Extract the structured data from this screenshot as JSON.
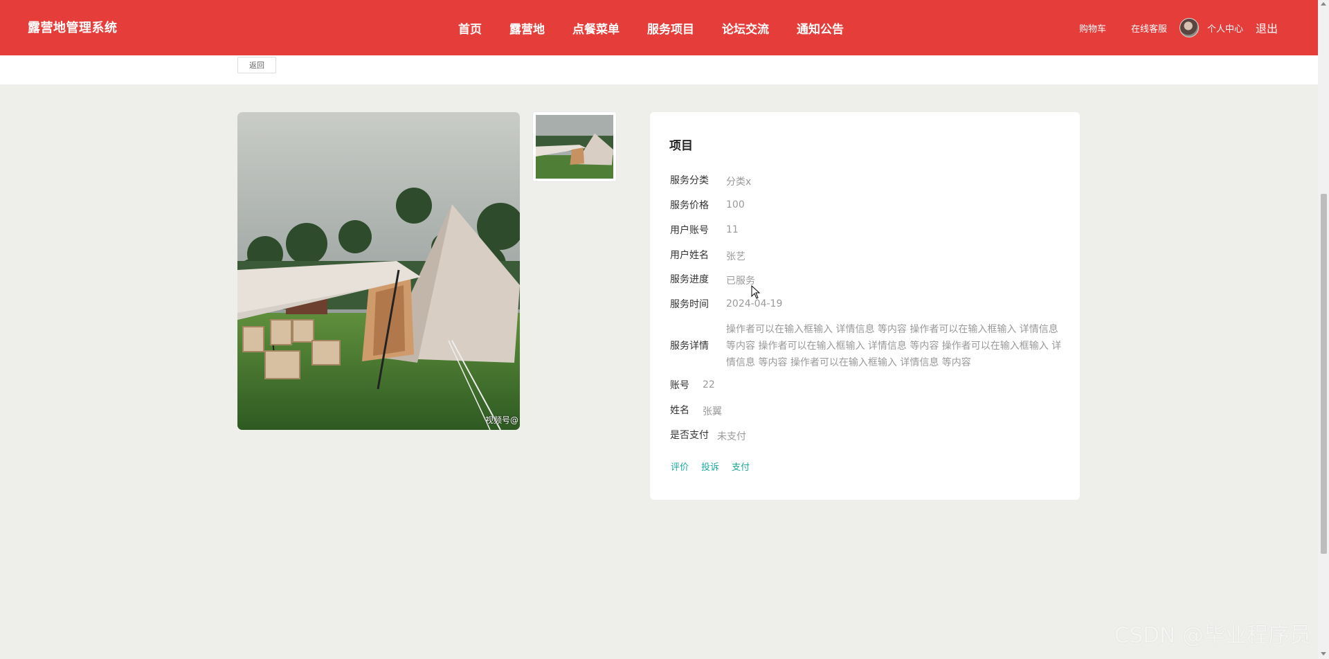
{
  "header": {
    "brand": "露营地管理系统",
    "nav": [
      "首页",
      "露营地",
      "点餐菜单",
      "服务项目",
      "论坛交流",
      "通知公告"
    ],
    "cart": "购物车",
    "online_service": "在线客服",
    "personal_center": "个人中心",
    "logout": "退出"
  },
  "back_button": "返回",
  "image": {
    "overlay_text": "视频号@"
  },
  "detail": {
    "title": "项目",
    "fields": [
      {
        "label": "服务分类",
        "value": "分类x"
      },
      {
        "label": "服务价格",
        "value": "100"
      },
      {
        "label": "用户账号",
        "value": "11"
      },
      {
        "label": "用户姓名",
        "value": "张艺"
      },
      {
        "label": "服务进度",
        "value": "已服务"
      },
      {
        "label": "服务时间",
        "value": "2024-04-19"
      }
    ],
    "service_detail_label": "服务详情",
    "service_detail_value": "操作者可以在输入框输入 详情信息 等内容 操作者可以在输入框输入 详情信息 等内容 操作者可以在输入框输入 详情信息 等内容 操作者可以在输入框输入 详情信息 等内容 操作者可以在输入框输入 详情信息 等内容",
    "account_label": "账号",
    "account_value": "22",
    "name_label": "姓名",
    "name_value": "张翼",
    "paid_label": "是否支付",
    "paid_value": "未支付",
    "actions": [
      "评价",
      "投诉",
      "支付"
    ]
  },
  "watermark": "CSDN @毕业程序员",
  "colors": {
    "header_bg": "#e53d39",
    "page_bg": "#eeeeeb",
    "action_link": "#1aaa9c"
  },
  "icons": [
    "avatar-image",
    "cursor-arrow-icon"
  ]
}
